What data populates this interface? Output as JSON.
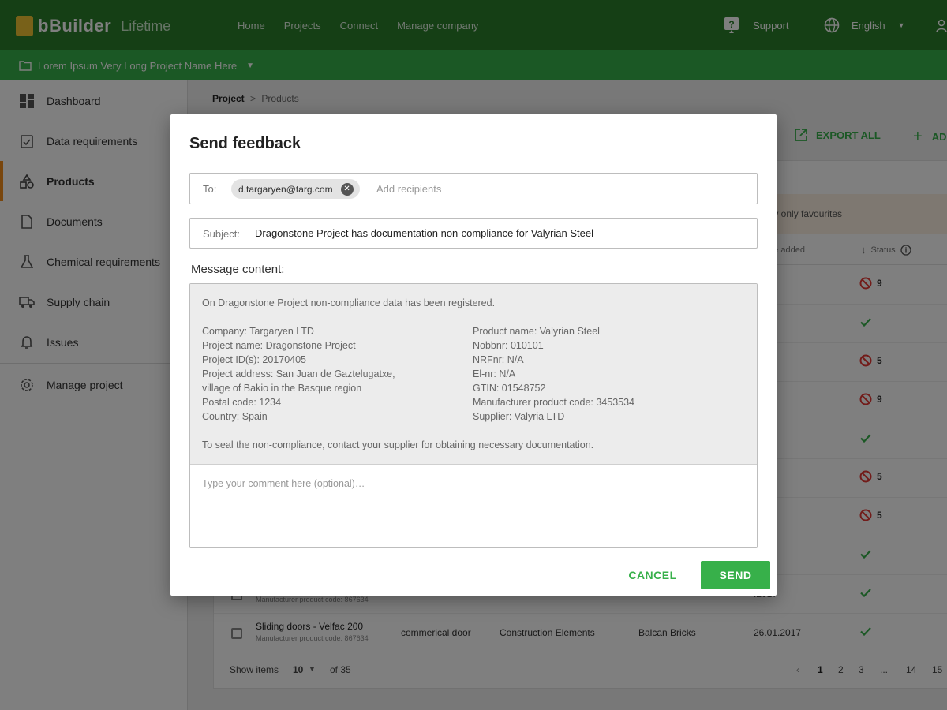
{
  "topbar": {
    "logo_text": "bBuilder",
    "logo_sub": "Lifetime",
    "nav": [
      "Home",
      "Projects",
      "Connect",
      "Manage company"
    ],
    "support_label": "Support",
    "language": "English",
    "icons": {
      "support": "help-icon",
      "language": "globe-icon",
      "user": "user-icon"
    }
  },
  "project_bar": {
    "project_name": "Lorem Ipsum Very Long Project Name Here"
  },
  "sidebar": {
    "items": [
      {
        "label": "Dashboard",
        "icon": "dashboard-icon"
      },
      {
        "label": "Data requirements",
        "icon": "clipboard-check-icon"
      },
      {
        "label": "Products",
        "icon": "shapes-icon",
        "active": true
      },
      {
        "label": "Documents",
        "icon": "document-icon"
      },
      {
        "label": "Chemical requirements",
        "icon": "flask-icon"
      },
      {
        "label": "Supply chain",
        "icon": "truck-icon"
      },
      {
        "label": "Issues",
        "icon": "bell-icon"
      },
      {
        "label": "Manage project",
        "icon": "gear-icon"
      }
    ]
  },
  "page": {
    "breadcrumb": {
      "root": "Project",
      "separator": ">",
      "current": "Products"
    },
    "export_label": "EXPORT ALL",
    "add_label": "AD",
    "favourites_label": "ow only favourites",
    "columns": {
      "date": "ate added",
      "status": "Status"
    },
    "rows": [
      {
        "date": ".2017",
        "status": "blocked",
        "count": "9"
      },
      {
        "date": ".2017",
        "status": "ok",
        "count": ""
      },
      {
        "date": ".2017",
        "status": "blocked",
        "count": "5"
      },
      {
        "date": ".2017",
        "status": "blocked",
        "count": "9"
      },
      {
        "date": ".2017",
        "status": "ok",
        "count": ""
      },
      {
        "date": ".2017",
        "status": "blocked",
        "count": "5"
      },
      {
        "date": ".2017",
        "status": "blocked",
        "count": "5"
      },
      {
        "date": ".2017",
        "status": "ok",
        "count": ""
      },
      {
        "date": ".2017",
        "status": "ok",
        "count": "",
        "sub": "Manufacturer product code: 867634"
      },
      {
        "name": "Sliding doors - Velfac 200",
        "sub": "Manufacturer product code: 867634",
        "category": "commerical door",
        "group": "Construction Elements",
        "supplier": "Balcan Bricks",
        "date": "26.01.2017",
        "status": "ok",
        "count": ""
      }
    ],
    "pager": {
      "show_label": "Show items",
      "show_value": "10",
      "of_label": "of 35",
      "pages": [
        "1",
        "2",
        "3",
        "...",
        "14",
        "15"
      ],
      "current": "1"
    },
    "colors": {
      "green": "#37b04a",
      "red": "#e53935",
      "accent": "#f28c1b"
    }
  },
  "modal": {
    "title": "Send feedback",
    "to_label": "To:",
    "recipient": "d.targaryen@targ.com",
    "recipients_placeholder": "Add recipients",
    "subject_label": "Subject:",
    "subject_value": "Dragonstone Project has documentation non-compliance for Valyrian Steel",
    "message_label": "Message content:",
    "message": {
      "intro": "On Dragonstone Project non-compliance data has been registered.",
      "left": [
        "Company: Targaryen LTD",
        "Project name: Dragonstone Project",
        "Project ID(s): 20170405",
        "Project address: San Juan de Gaztelugatxe,",
        "village of Bakio in the Basque region",
        "Postal code: 1234",
        "Country: Spain"
      ],
      "right": [
        "Product name: Valyrian Steel",
        "Nobbnr: 010101",
        "NRFnr: N/A",
        "El-nr: N/A",
        "GTIN: 01548752",
        "Manufacturer product code: 3453534",
        "Supplier: Valyria LTD"
      ],
      "outro": "To seal the non-compliance, contact your supplier for obtaining necessary documentation."
    },
    "comment_placeholder": "Type your comment here (optional)…",
    "cancel_label": "CANCEL",
    "send_label": "SEND"
  }
}
